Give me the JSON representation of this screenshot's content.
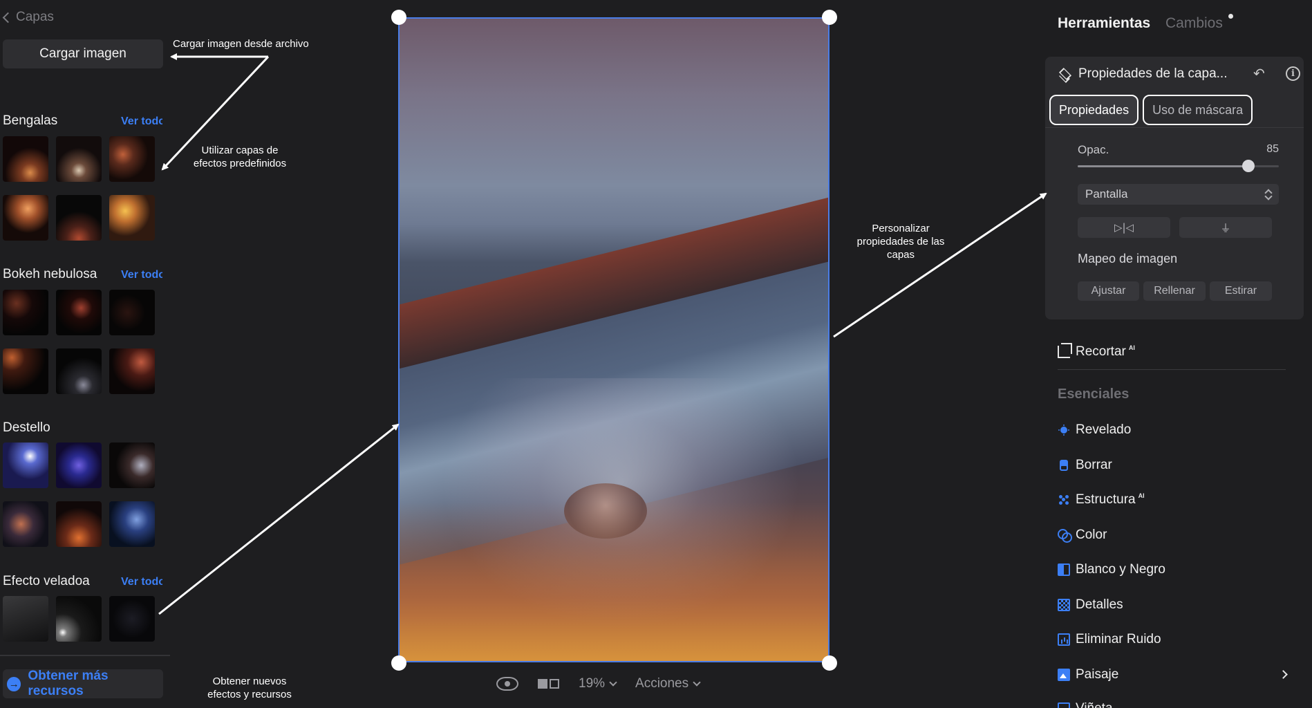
{
  "left_panel": {
    "back_label": "Capas",
    "load_button": "Cargar imagen",
    "categories": [
      {
        "title": "Bengalas",
        "see_all": "Ver todo"
      },
      {
        "title": "Bokeh nebulosa",
        "see_all": "Ver todo"
      },
      {
        "title": "Destello",
        "see_all": "Ver todo"
      },
      {
        "title": "Efecto veladoa",
        "see_all": "Ver todo"
      }
    ],
    "more_resources": "Obtener más recursos"
  },
  "annotations": {
    "load": "Cargar imagen desde archivo",
    "presets": [
      "Utilizar capas de",
      "efectos predefinidos"
    ],
    "customize": [
      "Personalizar",
      "propiedades de las",
      "capas"
    ],
    "resources": [
      "Obtener nuevos",
      "efectos y recursos"
    ]
  },
  "canvas_toolbar": {
    "zoom": "19%",
    "actions": "Acciones"
  },
  "right_panel": {
    "tabs": {
      "tools": "Herramientas",
      "changes": "Cambios"
    },
    "layer_props": {
      "title": "Propiedades de la capa...",
      "tab_properties": "Propiedades",
      "tab_mask": "Uso de máscara",
      "opacity_label": "Opac.",
      "opacity_value": "85",
      "opacity_fraction": 0.85,
      "blend_mode": "Pantalla",
      "flip_h_glyph": "▷|◁",
      "flip_v_glyph": "⏚",
      "mapping_label": "Mapeo de imagen",
      "mapping_options": [
        "Ajustar",
        "Rellenar",
        "Estirar"
      ]
    },
    "crop": {
      "label": "Recortar",
      "badge": "AI"
    },
    "essentials": {
      "title": "Esenciales",
      "items": [
        {
          "label": "Revelado",
          "icon": "sun-icon",
          "badge": ""
        },
        {
          "label": "Borrar",
          "icon": "eraser-icon",
          "badge": ""
        },
        {
          "label": "Estructura",
          "icon": "structure-icon",
          "badge": "AI"
        },
        {
          "label": "Color",
          "icon": "color-icon",
          "badge": ""
        },
        {
          "label": "Blanco y Negro",
          "icon": "black-white-icon",
          "badge": ""
        },
        {
          "label": "Detalles",
          "icon": "details-icon",
          "badge": ""
        },
        {
          "label": "Eliminar Ruido",
          "icon": "denoise-icon",
          "badge": ""
        },
        {
          "label": "Paisaje",
          "icon": "landscape-icon",
          "badge": ""
        },
        {
          "label": "Viñeta",
          "icon": "vignette-icon",
          "badge": ""
        }
      ]
    }
  },
  "colors": {
    "accent": "#3c7ff5",
    "panel": "#2b2b2e",
    "background": "#1e1e20",
    "selection": "#4a7de8"
  }
}
